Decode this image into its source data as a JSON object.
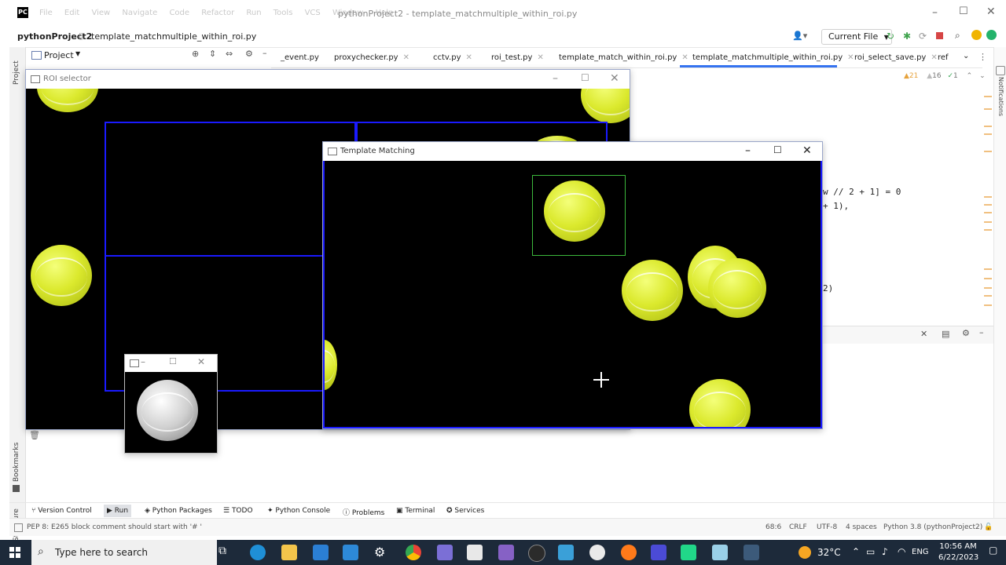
{
  "ide": {
    "logo": "PC",
    "menu": [
      "File",
      "Edit",
      "View",
      "Navigate",
      "Code",
      "Refactor",
      "Run",
      "Tools",
      "VCS",
      "Window",
      "Help"
    ],
    "window_title": "pythonProject2 - template_matchmultiple_within_roi.py",
    "project_name": "pythonProject2",
    "breadcrumb_file": "template_matchmultiple_within_roi.py",
    "current_file_label": "Current File",
    "project_panel_label": "Project",
    "left_strip": {
      "project": "Project",
      "bookmarks": "Bookmarks",
      "structure": "Structure"
    },
    "notifications_label": "Notifications",
    "tabs": [
      {
        "label": "_event.py"
      },
      {
        "label": "proxychecker.py"
      },
      {
        "label": "cctv.py"
      },
      {
        "label": "roi_test.py"
      },
      {
        "label": "template_match_within_roi.py"
      },
      {
        "label": "template_matchmultiple_within_roi.py",
        "active": true
      },
      {
        "label": "roi_select_save.py"
      },
      {
        "label": "ref"
      }
    ],
    "inspections": {
      "warnings": "21",
      "weak_warnings": "16",
      "typos": "1"
    },
    "code_lines": [
      "w // 2 + 1] = 0",
      "+ 1),",
      "2)"
    ],
    "tool_windows": [
      "Version Control",
      "Run",
      "Python Packages",
      "TODO",
      "Python Console",
      "Problems",
      "Terminal",
      "Services"
    ],
    "status_message": "PEP 8: E265 block comment should start with '# '",
    "status_right": {
      "position": "68:6",
      "line_sep": "CRLF",
      "encoding": "UTF-8",
      "indent": "4 spaces",
      "interpreter": "Python 3.8 (pythonProject2)"
    }
  },
  "roi_window": {
    "title": "ROI selector"
  },
  "template_window": {
    "title": "Template Matching"
  },
  "taskbar": {
    "search_placeholder": "Type here to search",
    "weather": "32°C",
    "language": "ENG",
    "time": "10:56 AM",
    "date": "6/22/2023"
  },
  "colors": {
    "roi_rect": "#1a1aff",
    "match_rect": "#3cb83c",
    "accent": "#3573f0"
  }
}
